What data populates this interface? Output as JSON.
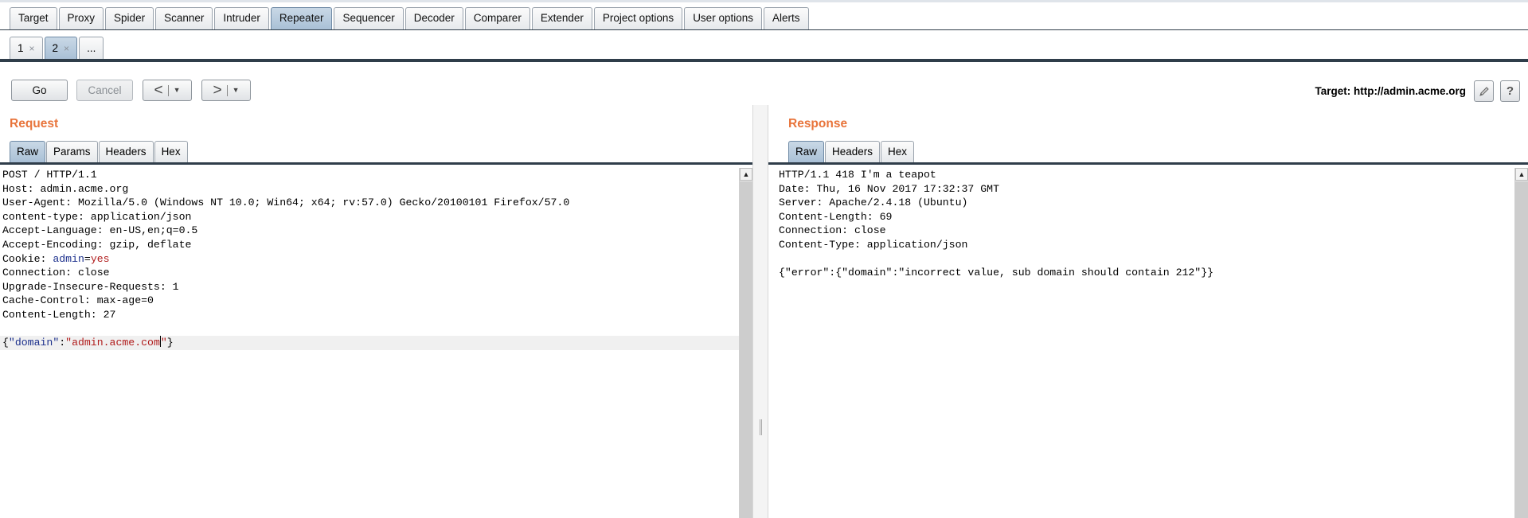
{
  "tool_tabs": [
    "Target",
    "Proxy",
    "Spider",
    "Scanner",
    "Intruder",
    "Repeater",
    "Sequencer",
    "Decoder",
    "Comparer",
    "Extender",
    "Project options",
    "User options",
    "Alerts"
  ],
  "active_tool_tab": "Repeater",
  "repeater_tabs": [
    {
      "label": "1",
      "close": "×"
    },
    {
      "label": "2",
      "close": "×"
    },
    {
      "label": "..."
    }
  ],
  "active_repeater_tab": "2",
  "controls": {
    "go_label": "Go",
    "cancel_label": "Cancel",
    "back_chevron": "<",
    "forward_chevron": ">",
    "dropdown_glyph": "▼",
    "target_label": "Target: http://admin.acme.org"
  },
  "request": {
    "title": "Request",
    "tabs": [
      "Raw",
      "Params",
      "Headers",
      "Hex"
    ],
    "active_tab": "Raw",
    "lines": [
      "POST / HTTP/1.1",
      "Host: admin.acme.org",
      "User-Agent: Mozilla/5.0 (Windows NT 10.0; Win64; x64; rv:57.0) Gecko/20100101 Firefox/57.0",
      "content-type: application/json",
      "Accept-Language: en-US,en;q=0.5",
      "Accept-Encoding: gzip, deflate",
      "",
      "Connection: close",
      "Upgrade-Insecure-Requests: 1",
      "Cache-Control: max-age=0",
      "Content-Length: 27",
      ""
    ],
    "cookie": {
      "prefix": "Cookie: ",
      "name": "admin",
      "eq": "=",
      "value": "yes"
    },
    "body": {
      "open": "{",
      "key": "\"domain\"",
      "colon": ":",
      "value_start": "\"admin.acme.com",
      "value_end": "\"",
      "close": "}"
    }
  },
  "response": {
    "title": "Response",
    "tabs": [
      "Raw",
      "Headers",
      "Hex"
    ],
    "active_tab": "Raw",
    "lines": [
      "HTTP/1.1 418 I'm a teapot",
      "Date: Thu, 16 Nov 2017 17:32:37 GMT",
      "Server: Apache/2.4.18 (Ubuntu)",
      "Content-Length: 69",
      "Connection: close",
      "Content-Type: application/json",
      "",
      "{\"error\":{\"domain\":\"incorrect value, sub domain should contain 212\"}}"
    ]
  },
  "scroll_up_glyph": "▲",
  "help_glyph": "?"
}
